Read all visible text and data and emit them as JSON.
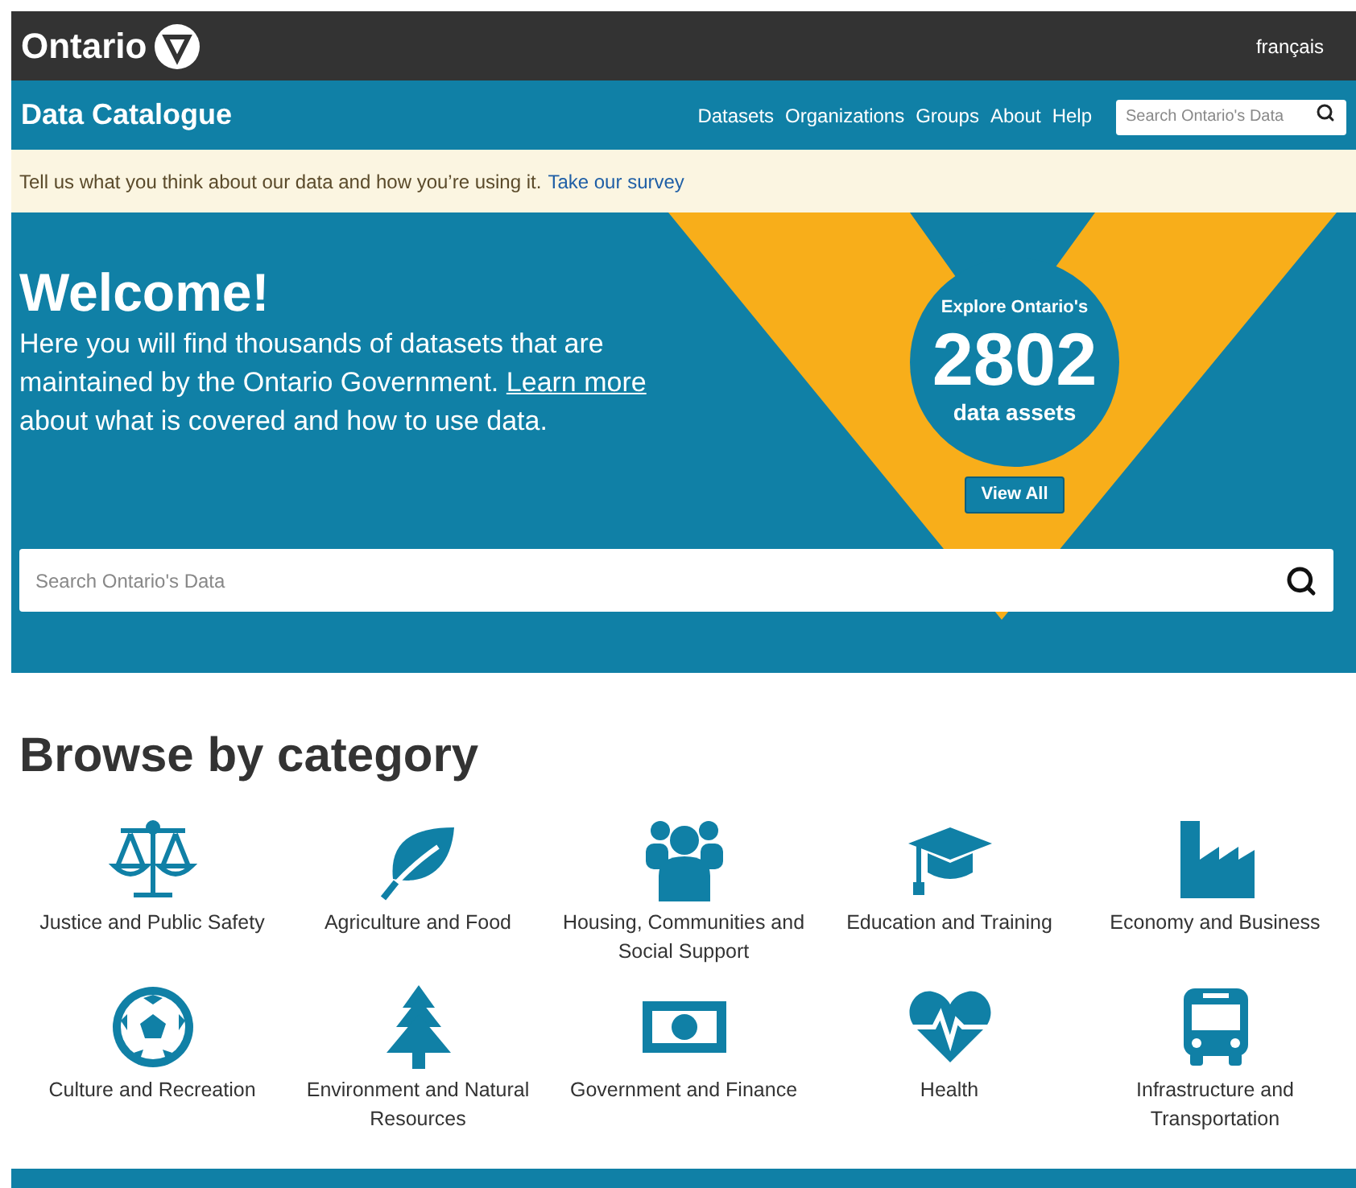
{
  "top_bar": {
    "logo_text": "Ontario",
    "language_link": "français"
  },
  "nav": {
    "title": "Data Catalogue",
    "links": [
      "Datasets",
      "Organizations",
      "Groups",
      "About",
      "Help"
    ],
    "search": {
      "placeholder": "Search Ontario's Data"
    }
  },
  "banner": {
    "text": "Tell us what you think about our data and how you’re using it.",
    "link": "Take our survey"
  },
  "hero": {
    "heading": "Welcome!",
    "intro_before": "Here you will find thousands of datasets that are maintained by the Ontario Government.",
    "intro_link": "Learn more",
    "intro_after": "about what is covered and how to use data.",
    "counter": {
      "label_top": "Explore Ontario's",
      "count": "2802",
      "label_bottom": "data assets"
    },
    "button": "View All",
    "search": {
      "placeholder": "Search Ontario's Data"
    }
  },
  "browse": {
    "heading": "Browse by category",
    "categories": [
      {
        "kind": "scales",
        "label": "Justice and Public Safety"
      },
      {
        "kind": "leaf",
        "label": "Agriculture and Food"
      },
      {
        "kind": "people",
        "label": "Housing, Communities and Social Support"
      },
      {
        "kind": "cap",
        "label": "Education and Training"
      },
      {
        "kind": "factory",
        "label": "Economy and Business"
      },
      {
        "kind": "ball",
        "label": "Culture and Recreation"
      },
      {
        "kind": "tree",
        "label": "Environment and Natural Resources"
      },
      {
        "kind": "money",
        "label": "Government and Finance"
      },
      {
        "kind": "heart",
        "label": "Health"
      },
      {
        "kind": "bus",
        "label": "Infrastructure and Transportation"
      }
    ]
  }
}
